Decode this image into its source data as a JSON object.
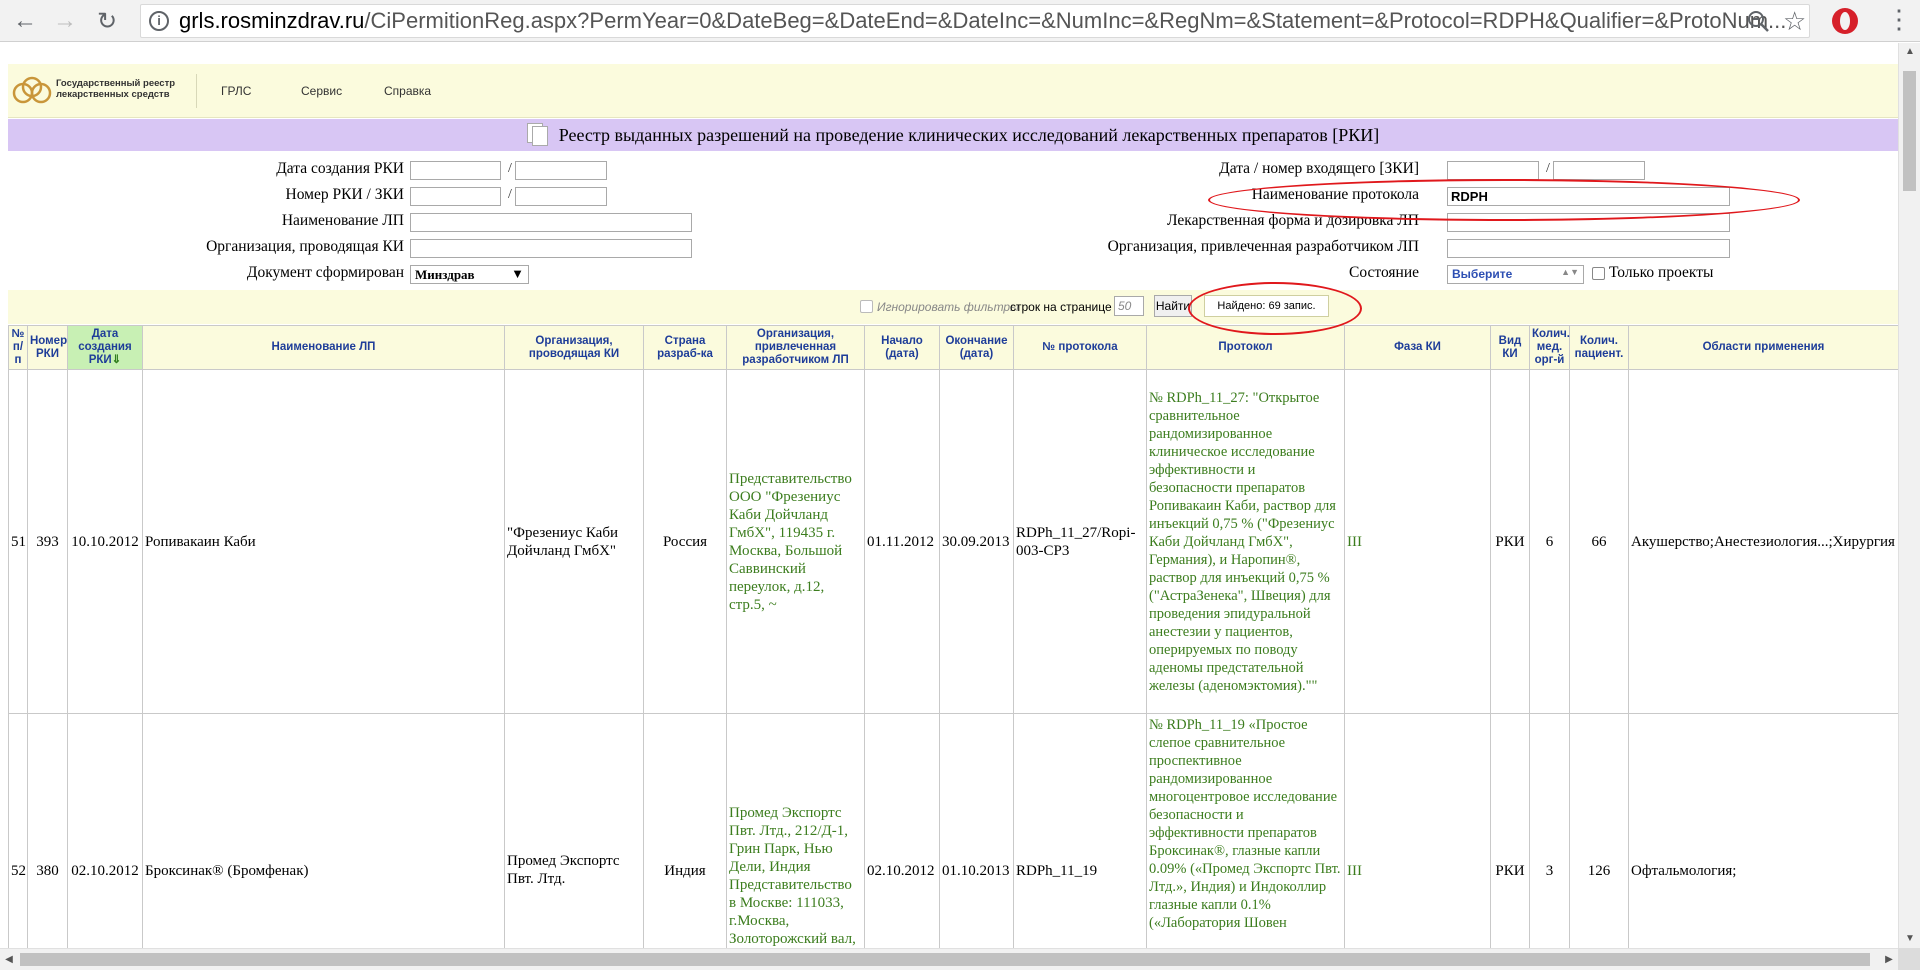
{
  "browser": {
    "url_host": "grls.rosminzdrav.ru",
    "url_path": "/CiPermitionReg.aspx?PermYear=0&DateBeg=&DateEnd=&DateInc=&NumInc=&RegNm=&Statement=&Protocol=RDPH&Qualifier=&ProtoNum..."
  },
  "site": {
    "logo_line1": "Государственный реестр",
    "logo_line2": "лекарственных средств",
    "menu": [
      "ГРЛС",
      "Сервис",
      "Справка"
    ]
  },
  "page_title": "Реестр выданных разрешений на проведение клинических исследований лекарственных препаратов [РКИ]",
  "filters": {
    "date_created_label": "Дата создания РКИ",
    "rki_number_label": "Номер РКИ / ЗКИ",
    "lp_name_label": "Наименование ЛП",
    "org_conducting_label": "Организация, проводящая КИ",
    "document_label": "Документ сформирован",
    "document_value": "Минздрав",
    "incoming_label": "Дата / номер входящего [ЗКИ]",
    "protocol_name_label": "Наименование протокола",
    "protocol_name_value": "RDPH",
    "dosage_form_label": "Лекарственная форма и дозировка ЛП",
    "org_developer_label": "Организация, привлеченная разработчиком ЛП",
    "state_label": "Состояние",
    "state_value": "Выберите",
    "only_projects_label": "Только проекты",
    "slash": "/"
  },
  "search": {
    "ignore_filters_label": "Игнорировать фильтры",
    "rows_per_page_label": "строк на странице",
    "rows_per_page_value": "50",
    "find_button": "Найти",
    "found_text": "Найдено: 69 запис."
  },
  "table": {
    "headers": {
      "num": "№ п/п",
      "rki_num": "Номер РКИ",
      "date_created": "Дата создания РКИ",
      "lp_name": "Наименование ЛП",
      "org_conducting": "Организация, проводящая КИ",
      "country": "Страна разраб-ка",
      "org_developer": "Организация, привлеченная разработчиком ЛП",
      "start": "Начало (дата)",
      "end": "Окончание (дата)",
      "protocol_num": "№ протокола",
      "protocol": "Протокол",
      "phase": "Фаза КИ",
      "kind": "Вид КИ",
      "orgs_count": "Колич. мед. орг-й",
      "patients_count": "Колич. пациент.",
      "areas": "Области применения"
    },
    "sort_arrow": "⇓",
    "rows": [
      {
        "num": "51",
        "rki_num": "393",
        "date_created": "10.10.2012",
        "lp_name": "Ропивакаин Каби",
        "org_conducting": "\"Фрезениус Каби Дойчланд ГмбХ\"",
        "country": "Россия",
        "org_developer": "Представительство ООО \"Фрезениус Каби Дойчланд ГмбХ\", 119435 г. Москва, Большой Саввинский переулок, д.12, стр.5, ~",
        "start": "01.11.2012",
        "end": "30.09.2013",
        "protocol_num": "RDPh_11_27/Ropi-003-CP3",
        "protocol": "№ RDPh_11_27: \"Открытое сравнительное рандомизированное клиническое исследование эффективности и безопасности препаратов Ропивакаин Каби, раствор для инъекций 0,75 % (\"Фрезениус Каби Дойчланд ГмбХ\", Германия), и Наропин®, раствор для инъекций 0,75 % (\"АстраЗенека\", Швеция) для проведения эпидуральной анестезии у пациентов, оперируемых по поводу аденомы предстательной железы (аденомэктомия).\"\"",
        "phase": "III",
        "kind": "РКИ",
        "orgs_count": "6",
        "patients_count": "66",
        "areas": "Акушерство;Анестезиология...;Хирургия"
      },
      {
        "num": "52",
        "rki_num": "380",
        "date_created": "02.10.2012",
        "lp_name": "Броксинак® (Бромфенак)",
        "org_conducting": "Промед Экспортс Пвт. Лтд.",
        "country": "Индия",
        "org_developer": "Промед Экспортс Пвт. Лтд., 212/Д-1, Грин Парк, Нью Дели, Индия Представительство в Москве: 111033, г.Москва, Золоторожский вал,",
        "start": "02.10.2012",
        "end": "01.10.2013",
        "protocol_num": "RDPh_11_19",
        "protocol": "№ RDPh_11_19 «Простое слепое сравнительное проспективное рандомизированное многоцентровое исследование безопасности и эффективности препаратов Броксинак®, глазные капли 0.09% («Промед Экспортс Пвт. Лтд.», Индия) и Индоколлир глазные капли 0.1% («Лаборатория Шовен",
        "phase": "III",
        "kind": "РКИ",
        "orgs_count": "3",
        "patients_count": "126",
        "areas": "Офтальмология;"
      }
    ]
  }
}
